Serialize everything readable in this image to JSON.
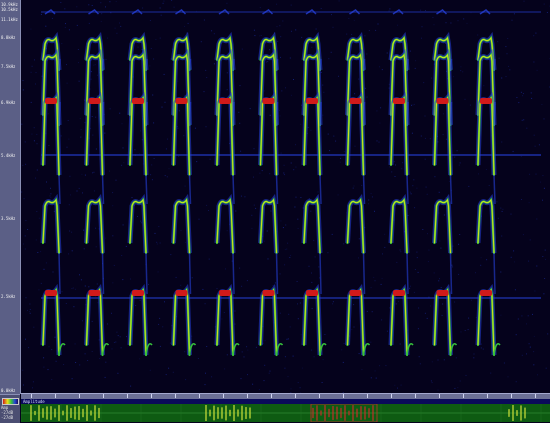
{
  "frequency_axis": {
    "labels": [
      "10.9kHz",
      "10.5kHz",
      "11.1kHz",
      "8.8kHz",
      "7.5kHz",
      "6.9kHz",
      "5.4kHz",
      "3.5kHz",
      "2.5kHz",
      "0.0kHz"
    ]
  },
  "corner": {
    "label_1": "Amp",
    "label_2": "-27dB",
    "label_3": "-27dB"
  },
  "waveform": {
    "title": "Amplitude",
    "colors": {
      "background": "#0e5b12",
      "trace": "#cfe23a",
      "selection": "#c2302a"
    }
  },
  "spectrogram": {
    "palette": [
      "#1a0f55",
      "#2540d8",
      "#37c23b",
      "#e7e21c",
      "#d11a1a"
    ],
    "call_count": 11
  }
}
